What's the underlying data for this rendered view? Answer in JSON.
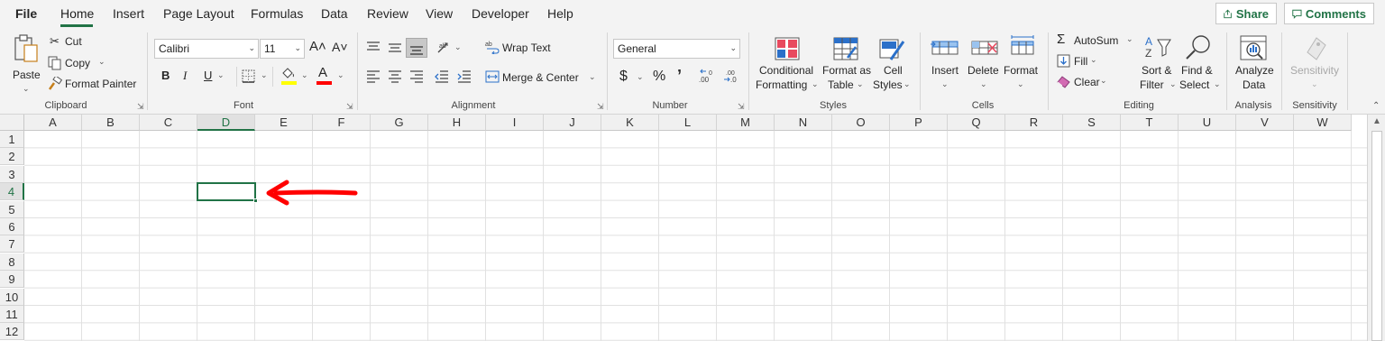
{
  "menu": {
    "items": [
      "File",
      "Home",
      "Insert",
      "Page Layout",
      "Formulas",
      "Data",
      "Review",
      "View",
      "Developer",
      "Help"
    ],
    "active": "Home",
    "share_label": "Share",
    "comments_label": "Comments"
  },
  "clipboard": {
    "paste": "Paste",
    "cut": "Cut",
    "copy": "Copy",
    "format_painter": "Format Painter",
    "label": "Clipboard"
  },
  "font": {
    "family": "Calibri",
    "size": "11",
    "bold": "B",
    "italic": "I",
    "underline": "U",
    "font_color_glyph": "A",
    "grow_glyph": "A˄",
    "shrink_glyph": "A˅",
    "label": "Font",
    "highlight_color": "#ffff00",
    "font_color": "#ff0000"
  },
  "alignment": {
    "wrap_text": "Wrap Text",
    "merge_center": "Merge & Center",
    "label": "Alignment"
  },
  "number": {
    "format": "General",
    "currency": "$",
    "percent": "%",
    "comma": "̗",
    "label": "Number"
  },
  "styles": {
    "conditional_formatting": [
      "Conditional",
      "Formatting"
    ],
    "format_as_table": [
      "Format as",
      "Table"
    ],
    "cell_styles": [
      "Cell",
      "Styles"
    ],
    "label": "Styles"
  },
  "cells": {
    "insert": "Insert",
    "delete": "Delete",
    "format": "Format",
    "label": "Cells"
  },
  "editing": {
    "autosum": "AutoSum",
    "fill": "Fill",
    "clear": "Clear",
    "sort_filter": [
      "Sort &",
      "Filter"
    ],
    "find_select": [
      "Find &",
      "Select"
    ],
    "label": "Editing"
  },
  "analysis": {
    "analyze_data": [
      "Analyze",
      "Data"
    ],
    "label": "Analysis"
  },
  "sensitivity": {
    "button": "Sensitivity",
    "label": "Sensitivity"
  },
  "grid": {
    "columns": [
      "A",
      "B",
      "C",
      "D",
      "E",
      "F",
      "G",
      "H",
      "I",
      "J",
      "K",
      "L",
      "M",
      "N",
      "O",
      "P",
      "Q",
      "R",
      "S",
      "T",
      "U",
      "V",
      "W"
    ],
    "rows": [
      "1",
      "2",
      "3",
      "4",
      "5",
      "6",
      "7",
      "8",
      "9",
      "10",
      "11",
      "12"
    ],
    "selected_column": "D",
    "selected_row": "4",
    "accent_color": "#217346",
    "annotation_color": "#ff0000"
  }
}
